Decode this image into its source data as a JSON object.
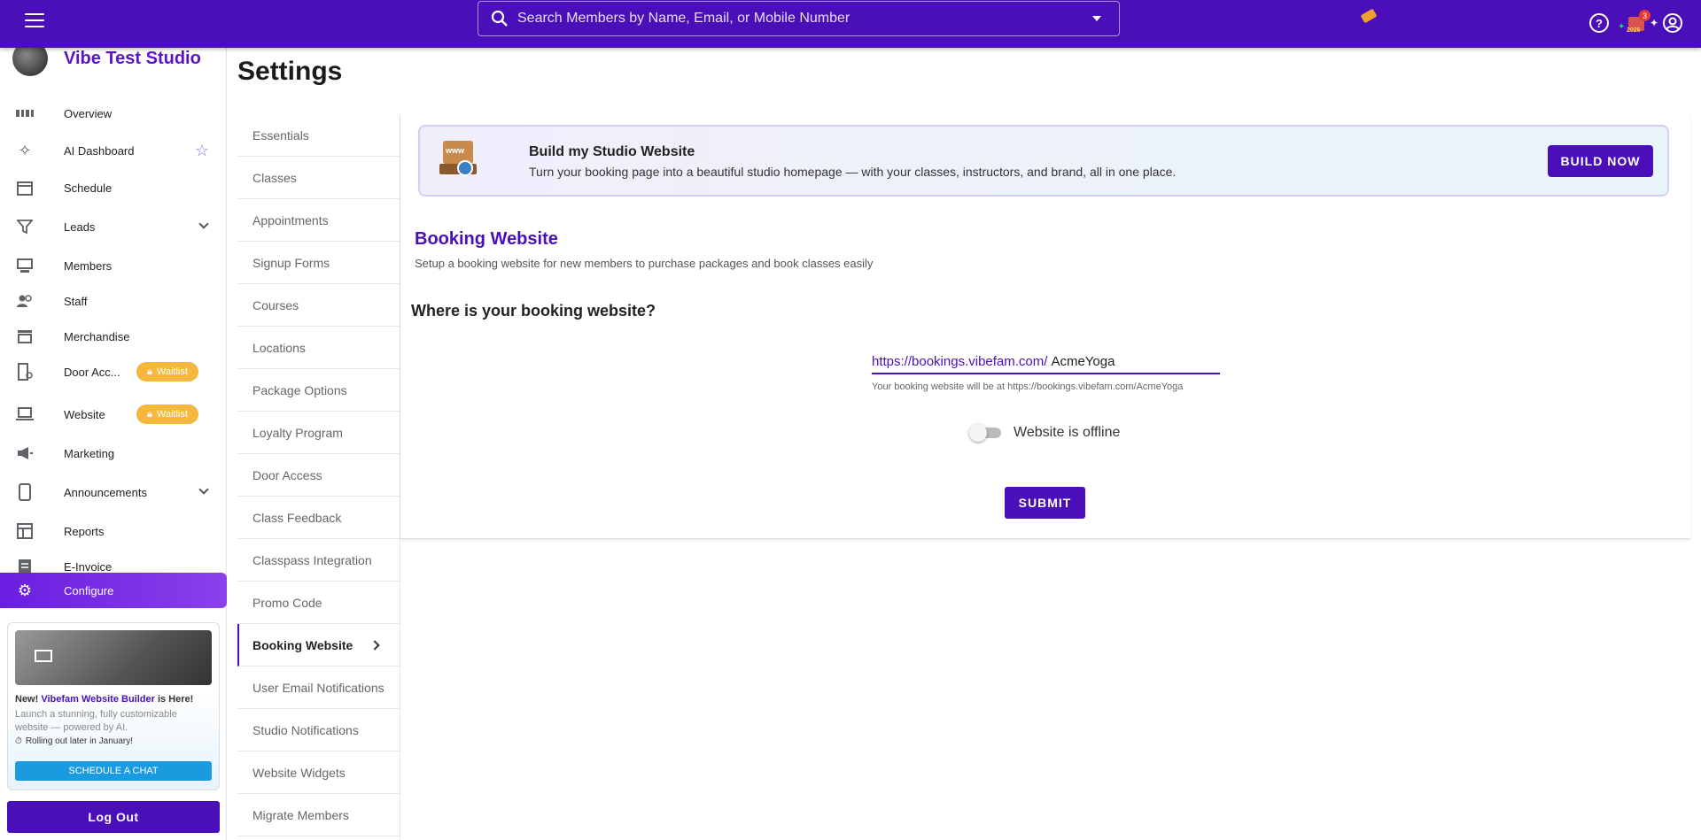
{
  "topbar": {
    "search_placeholder": "Search Members by Name, Email, or Mobile Number",
    "notification_count": "3",
    "gift_year": "2026",
    "help_symbol": "?"
  },
  "sidebar": {
    "studio_name": "Vibe Test Studio",
    "items": [
      {
        "label": "Overview",
        "icon": "dashboard-icon"
      },
      {
        "label": "AI Dashboard",
        "icon": "sparkle-icon"
      },
      {
        "label": "Schedule",
        "icon": "calendar-icon"
      },
      {
        "label": "Leads",
        "icon": "filter-icon"
      },
      {
        "label": "Members",
        "icon": "members-icon"
      },
      {
        "label": "Staff",
        "icon": "staff-icon"
      },
      {
        "label": "Merchandise",
        "icon": "store-icon"
      },
      {
        "label": "Door Acc...",
        "icon": "door-icon",
        "badge": "Waitlist"
      },
      {
        "label": "Website",
        "icon": "laptop-icon",
        "badge": "Waitlist"
      },
      {
        "label": "Marketing",
        "icon": "megaphone-icon"
      },
      {
        "label": "Announcements",
        "icon": "phone-icon"
      },
      {
        "label": "Reports",
        "icon": "table-icon"
      },
      {
        "label": "E-Invoice",
        "icon": "invoice-icon"
      },
      {
        "label": "Configure",
        "icon": "gear-icon",
        "active": true
      }
    ],
    "promo": {
      "prefix": "New!",
      "highlight": "Vibefam Website Builder",
      "suffix": "is Here!",
      "description": "Launch a stunning, fully customizable website — powered by AI.",
      "rollout": "Rolling out later in January!",
      "button": "SCHEDULE A CHAT"
    },
    "logout": "Log Out"
  },
  "page": {
    "title": "Settings"
  },
  "submenu": {
    "items": [
      "Essentials",
      "Classes",
      "Appointments",
      "Signup Forms",
      "Courses",
      "Locations",
      "Package Options",
      "Loyalty Program",
      "Door Access",
      "Class Feedback",
      "Classpass Integration",
      "Promo Code",
      "Booking Website",
      "User Email Notifications",
      "Studio Notifications",
      "Website Widgets",
      "Migrate Members"
    ],
    "active": "Booking Website"
  },
  "banner": {
    "title": "Build my Studio Website",
    "description": "Turn your booking page into a beautiful studio homepage — with your classes, instructors, and brand, all in one place.",
    "button": "BUILD NOW"
  },
  "booking": {
    "title": "Booking Website",
    "description": "Setup a booking website for new members to purchase packages and book classes easily",
    "question": "Where is your booking website?",
    "url_prefix": "https://bookings.vibefam.com/",
    "url_value": "AcmeYoga",
    "url_help": "Your booking website will be at https://bookings.vibefam.com/AcmeYoga",
    "toggle_label": "Website is offline",
    "toggle_on": false,
    "submit": "SUBMIT"
  }
}
